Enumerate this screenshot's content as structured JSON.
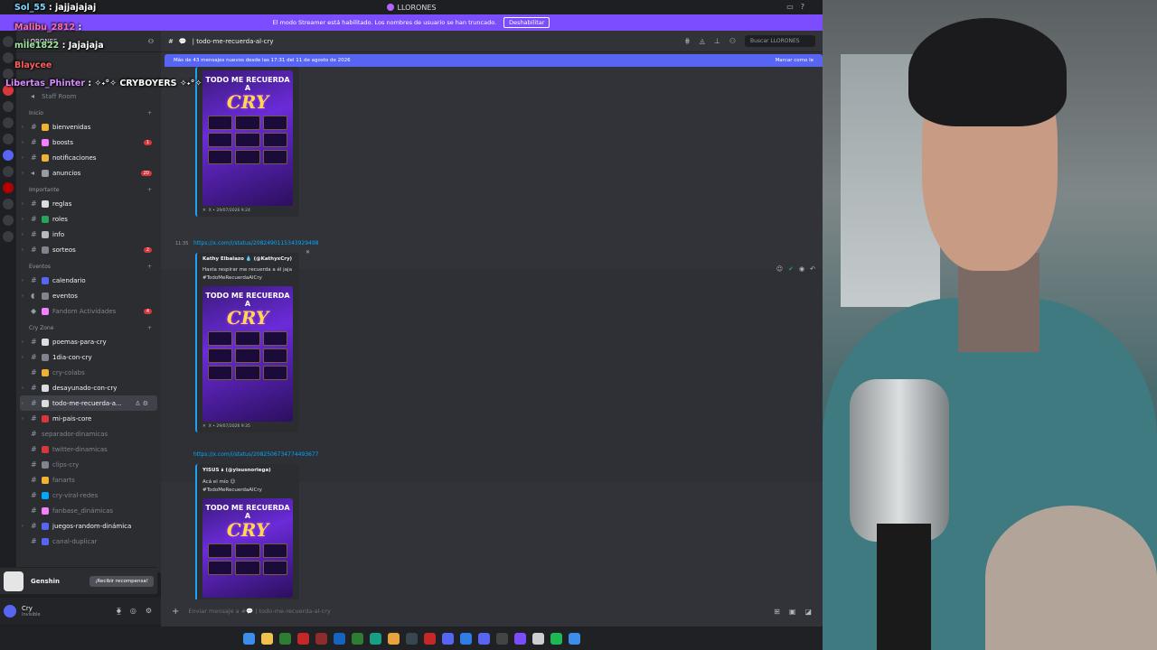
{
  "window": {
    "title": "LLORONES"
  },
  "banner": {
    "text": "El modo Streamer está habilitado. Los nombres de usuario se han truncado.",
    "button": "Deshabilitar"
  },
  "server": {
    "name": "LLORONES"
  },
  "sidebar": {
    "top_channel": "Staff Room",
    "categories": {
      "inicio": "Inicio",
      "importante": "Importante",
      "eventos": "Eventos",
      "cry_zone": "Cry Zone"
    },
    "channels": [
      {
        "label": "bienvenidas",
        "count": ""
      },
      {
        "label": "boosts",
        "count": "1"
      },
      {
        "label": "notificaciones",
        "count": ""
      },
      {
        "label": "anuncios",
        "count": "20"
      },
      {
        "label": "reglas",
        "count": ""
      },
      {
        "label": "roles",
        "count": ""
      },
      {
        "label": "info",
        "count": ""
      },
      {
        "label": "sorteos",
        "count": "2"
      },
      {
        "label": "calendario",
        "count": ""
      },
      {
        "label": "eventos",
        "count": ""
      },
      {
        "label": "Fandom Actividades",
        "count": "4"
      },
      {
        "label": "poemas-para-cry",
        "count": ""
      },
      {
        "label": "1dia-con-cry",
        "count": ""
      },
      {
        "label": "cry-colabs",
        "count": ""
      },
      {
        "label": "desayunado-con-cry",
        "count": ""
      },
      {
        "label": "todo-me-recuerda-a...",
        "count": ""
      },
      {
        "label": "mi-pais-core",
        "count": ""
      },
      {
        "label": "separador-dinamicas",
        "count": ""
      },
      {
        "label": "twitter-dinamicas",
        "count": ""
      },
      {
        "label": "clips-cry",
        "count": ""
      },
      {
        "label": "fanarts",
        "count": ""
      },
      {
        "label": "cry-viral-redes",
        "count": ""
      },
      {
        "label": "fanbase_dinámicas",
        "count": ""
      },
      {
        "label": "juegos-random-dinámica",
        "count": ""
      },
      {
        "label": "canal-duplicar",
        "count": ""
      }
    ]
  },
  "promo": {
    "game": "Genshin",
    "button": "¡Recibir recompensa!"
  },
  "user": {
    "name": "Cry",
    "status": "Invisible"
  },
  "header": {
    "channel": "todo-me-recuerda-al-cry",
    "search_placeholder": "Buscar LLORONES"
  },
  "new_messages": {
    "text": "Más de 43 mensajes nuevos desde las 17:31 del 11 de agosto de 2026",
    "action": "Marcar como le"
  },
  "messages": [
    {
      "footer": "X • 29/07/2026 9:24",
      "poster_title": "TODO ME RECUERDA A",
      "poster_name": "CRY"
    },
    {
      "time": "11:35",
      "link": "https://x.com/i/status/2082490115343929498",
      "author": "Kathy Elbalazo 💧 (@KathyxCry)",
      "text": "Hasta respirar me recuerda a él jaja #TodoMeRecuerdaAlCry",
      "footer": "X • 29/07/2026 9:35",
      "poster_title": "TODO ME RECUERDA A",
      "poster_name": "CRY"
    },
    {
      "link": "https://x.com/i/status/2082506734774493677",
      "author": "YISUS 🌢 (@yisusnoriega)",
      "text": "Acá el mío 😉 #TodoMeRecuerdaAlCry",
      "poster_title": "TODO ME RECUERDA A",
      "poster_name": "CRY"
    }
  ],
  "composer": {
    "placeholder": "Enviar mensaje a #💬 | todo-me-recuerda-al-cry"
  },
  "chat_overlay": [
    {
      "user": "Sol_55",
      "msg": ": jajjajajaj"
    },
    {
      "user": "Malibu_2812",
      "msg": ":"
    },
    {
      "user": "mile1822",
      "msg": ": Jajajaja"
    },
    {
      "user": "Blaycee",
      "msg": ""
    },
    {
      "user": "Libertas_Phinter",
      "msg": ": ✧˖°✧ CRYBOYERS ✧˖°✧"
    }
  ],
  "colors": {
    "accent": "#5865f2",
    "banner": "#7c4dff",
    "link": "#00a8fc"
  }
}
